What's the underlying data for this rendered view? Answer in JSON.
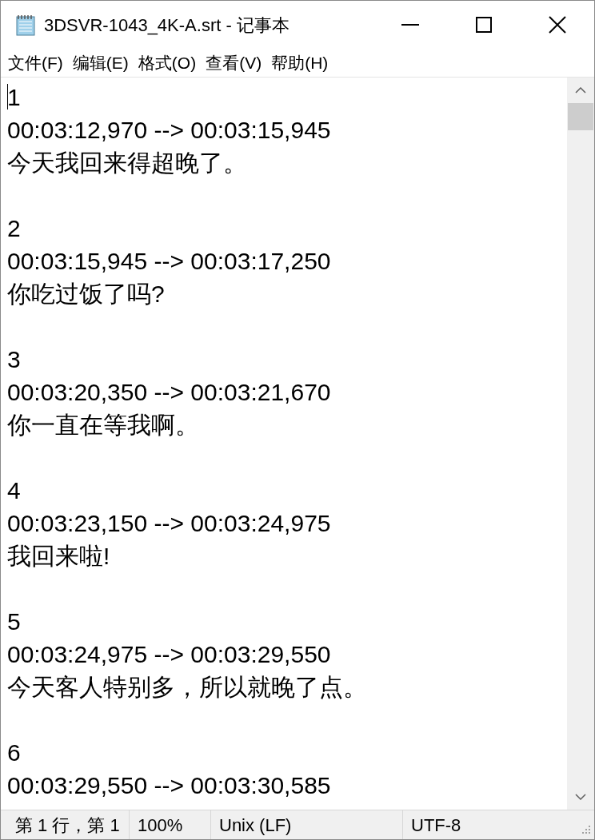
{
  "window": {
    "title": "3DSVR-1043_4K-A.srt - 记事本"
  },
  "menu": [
    {
      "label": "文件(F)"
    },
    {
      "label": "编辑(E)"
    },
    {
      "label": "格式(O)"
    },
    {
      "label": "查看(V)"
    },
    {
      "label": "帮助(H)"
    }
  ],
  "entries": [
    {
      "index": "1",
      "time": "00:03:12,970 --> 00:03:15,945",
      "text": "今天我回来得超晚了。"
    },
    {
      "index": "2",
      "time": "00:03:15,945 --> 00:03:17,250",
      "text": "你吃过饭了吗?"
    },
    {
      "index": "3",
      "time": "00:03:20,350 --> 00:03:21,670",
      "text": "你一直在等我啊。"
    },
    {
      "index": "4",
      "time": "00:03:23,150 --> 00:03:24,975",
      "text": "我回来啦!"
    },
    {
      "index": "5",
      "time": "00:03:24,975 --> 00:03:29,550",
      "text": "今天客人特别多，所以就晚了点。"
    },
    {
      "index": "6",
      "time": "00:03:29,550 --> 00:03:30,585"
    }
  ],
  "status_bar": [
    "第 1 行，第 1",
    "100%",
    "Unix (LF)",
    "UTF-8"
  ]
}
